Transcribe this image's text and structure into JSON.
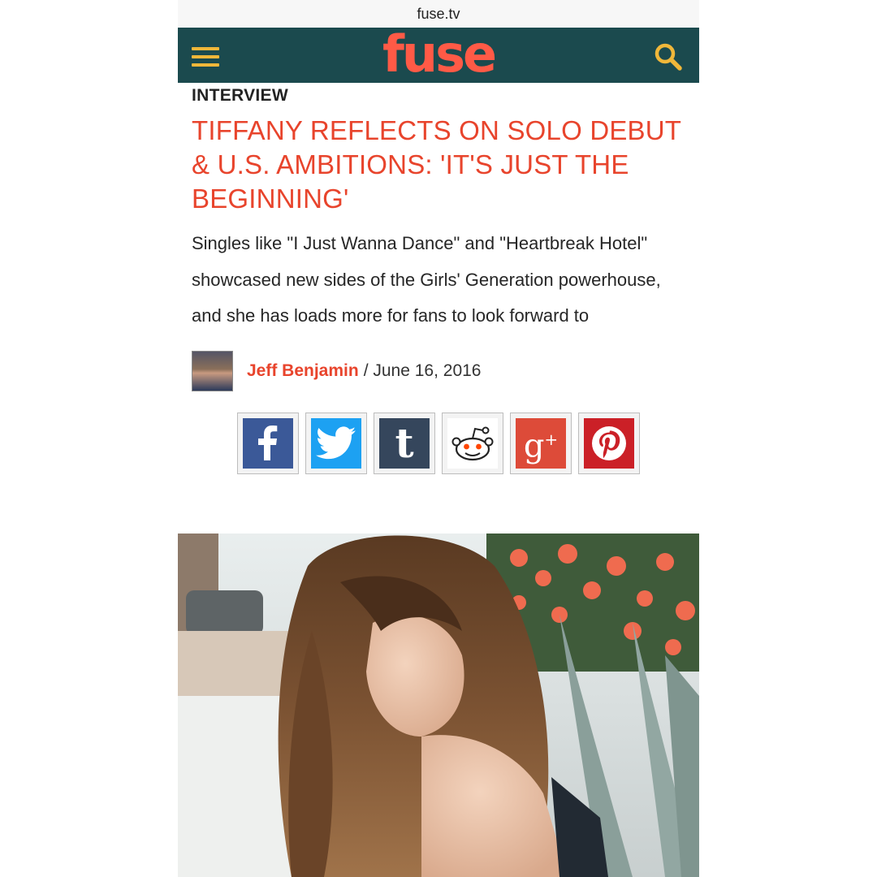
{
  "browser": {
    "url": "fuse.tv"
  },
  "header": {
    "logo": "fuse",
    "menu_icon": "hamburger-menu-icon",
    "search_icon": "search-icon",
    "bar_color": "#1b4a4e",
    "icon_color": "#f0b73a",
    "logo_color": "#ff5a46"
  },
  "article": {
    "kicker": "INTERVIEW",
    "headline": "TIFFANY REFLECTS ON SOLO DEBUT & U.S. AMBITIONS: 'IT'S JUST THE BEGINNING'",
    "dek": "Singles like \"I Just Wanna Dance\" and \"Heartbreak Hotel\" showcased new sides of the Girls' Generation powerhouse, and she has loads more for fans to look forward to",
    "author": "Jeff Benjamin",
    "date": "/ June 16, 2016",
    "accent_color": "#e8442c"
  },
  "share": [
    {
      "icon": "facebook-icon",
      "color": "#3b5998"
    },
    {
      "icon": "twitter-icon",
      "color": "#1da1f2"
    },
    {
      "icon": "tumblr-icon",
      "color": "#35465c"
    },
    {
      "icon": "reddit-icon",
      "color": "#ffffff"
    },
    {
      "icon": "google-plus-icon",
      "color": "#dd4b39"
    },
    {
      "icon": "pinterest-icon",
      "color": "#cb2027"
    }
  ]
}
